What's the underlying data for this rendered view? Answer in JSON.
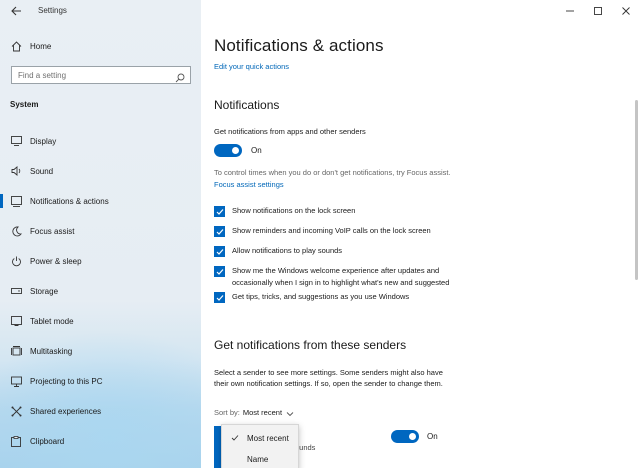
{
  "window": {
    "app_title": "Settings",
    "controls": [
      "—",
      "☐",
      "✕"
    ]
  },
  "sidebar": {
    "home_label": "Home",
    "search_placeholder": "Find a setting",
    "section_title": "System",
    "items": [
      {
        "label": "Display",
        "icon": "display-icon"
      },
      {
        "label": "Sound",
        "icon": "speaker-icon"
      },
      {
        "label": "Notifications & actions",
        "icon": "notification-icon",
        "active": true
      },
      {
        "label": "Focus assist",
        "icon": "moon-icon"
      },
      {
        "label": "Power & sleep",
        "icon": "power-icon"
      },
      {
        "label": "Storage",
        "icon": "storage-icon"
      },
      {
        "label": "Tablet mode",
        "icon": "tablet-icon"
      },
      {
        "label": "Multitasking",
        "icon": "multitasking-icon"
      },
      {
        "label": "Projecting to this PC",
        "icon": "projecting-icon"
      },
      {
        "label": "Shared experiences",
        "icon": "shared-icon"
      },
      {
        "label": "Clipboard",
        "icon": "clipboard-icon"
      }
    ]
  },
  "main": {
    "title": "Notifications & actions",
    "quick_actions_link": "Edit your quick actions",
    "notifications_heading": "Notifications",
    "get_notifications_label": "Get notifications from apps and other senders",
    "toggle_state": "On",
    "focus_hint": "To control times when you do or don't get notifications, try Focus assist.",
    "focus_link": "Focus assist settings",
    "checkboxes": [
      {
        "label": "Show notifications on the lock screen",
        "checked": true
      },
      {
        "label": "Show reminders and incoming VoIP calls on the lock screen",
        "checked": true
      },
      {
        "label": "Allow notifications to play sounds",
        "checked": true
      },
      {
        "label": "Show me the Windows welcome experience after updates and",
        "label_line2": "occasionally when I sign in to highlight what's new and suggested",
        "checked": true
      },
      {
        "label": "Get tips, tricks, and suggestions as you use Windows",
        "checked": true
      }
    ],
    "senders_heading": "Get notifications from these senders",
    "senders_desc_line1": "Select a sender to see more settings. Some senders might also have",
    "senders_desc_line2": "their own notification settings. If so, open the sender to change them.",
    "sort_by_label": "Sort by:",
    "sort_by_value": "Most recent",
    "sender_fragment": "ounds",
    "sender_toggle_state": "On"
  },
  "sort_dropdown": {
    "options": [
      {
        "label": "Most recent",
        "selected": true
      },
      {
        "label": "Name",
        "selected": false
      }
    ]
  },
  "colors": {
    "accent": "#0067c0",
    "link": "#0067b8"
  }
}
